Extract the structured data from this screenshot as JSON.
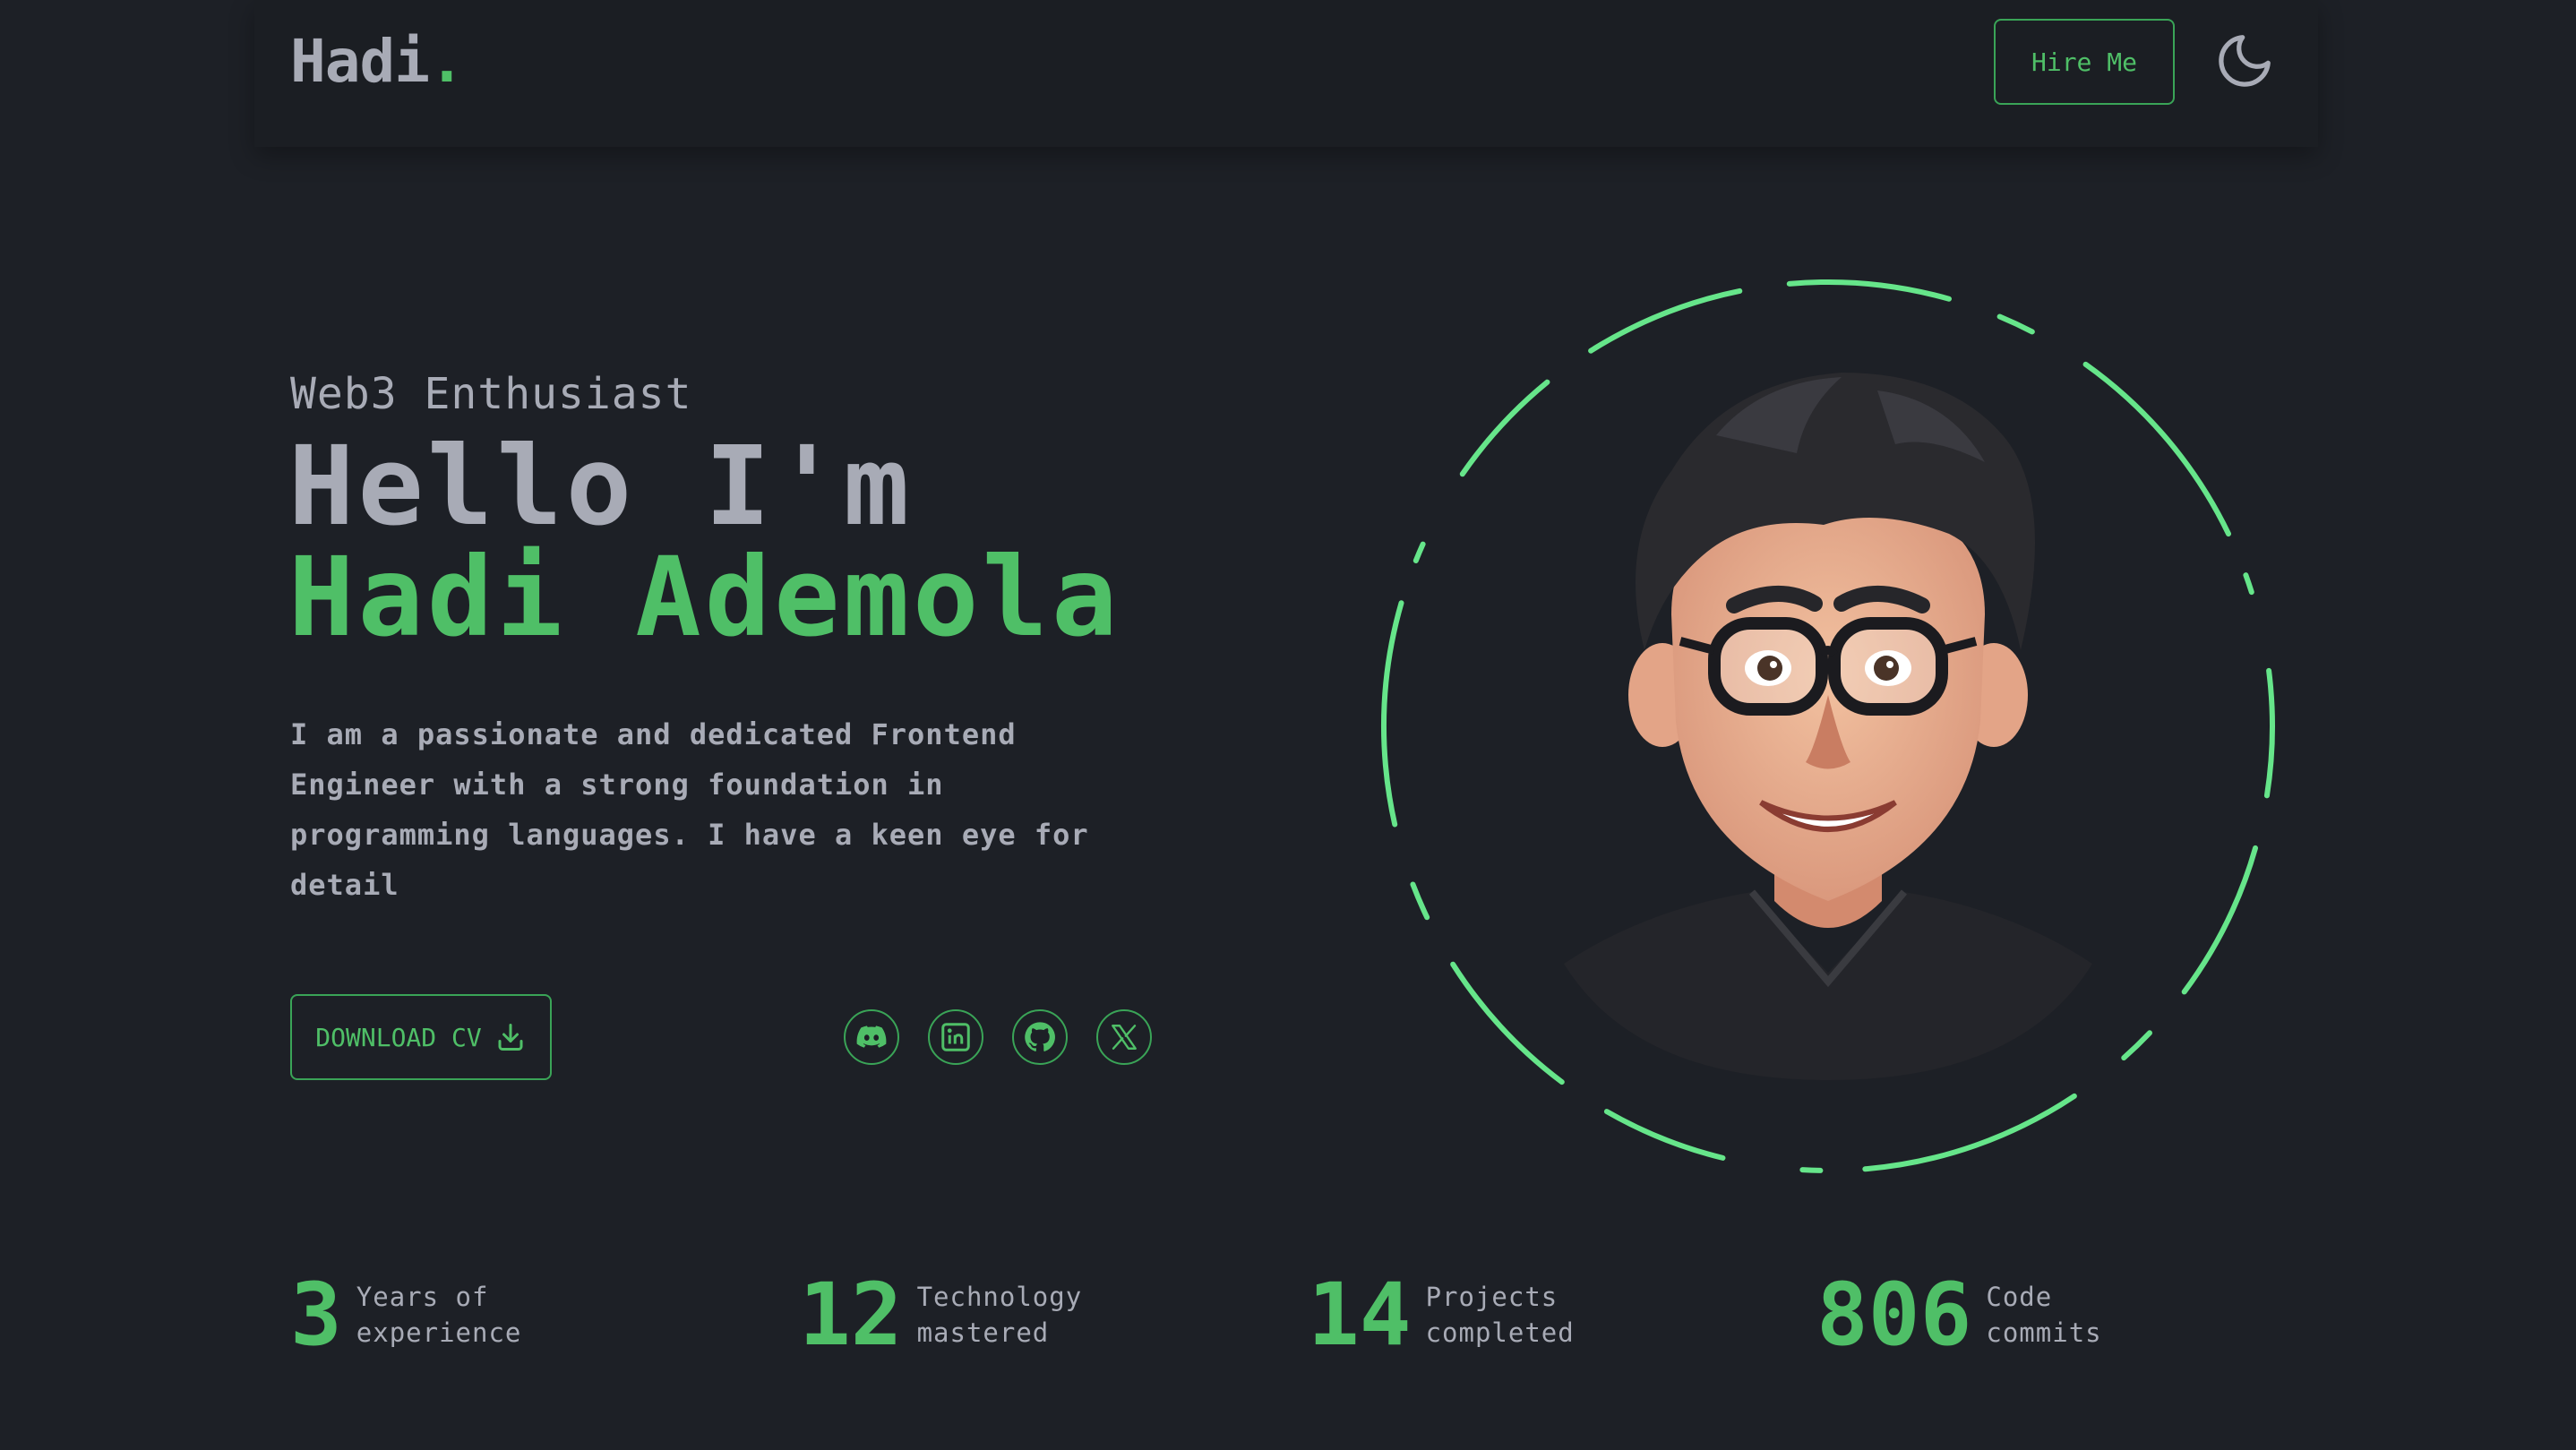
{
  "header": {
    "logo_text": "Hadi",
    "logo_dot": ".",
    "hire_label": "Hire Me",
    "theme_icon": "moon-icon"
  },
  "hero": {
    "eyebrow": "Web3 Enthusiast",
    "greeting": "Hello I'm",
    "name": "Hadi Ademola",
    "bio": "I am a passionate and dedicated Frontend Engineer with a strong foundation in programming languages. I have a keen eye for detail",
    "cv_label": "DOWNLOAD CV",
    "cv_icon": "download-icon",
    "socials": [
      {
        "icon": "discord-icon"
      },
      {
        "icon": "linkedin-icon"
      },
      {
        "icon": "github-icon"
      },
      {
        "icon": "x-twitter-icon"
      }
    ]
  },
  "stats": [
    {
      "value": "3",
      "label": "Years of experience"
    },
    {
      "value": "12",
      "label": "Technology mastered"
    },
    {
      "value": "14",
      "label": "Projects completed"
    },
    {
      "value": "806",
      "label": "Code commits"
    }
  ],
  "colors": {
    "background": "#1d2026",
    "accent": "#4fbf67",
    "ring": "#66e58a",
    "text": "#a8abb6"
  }
}
